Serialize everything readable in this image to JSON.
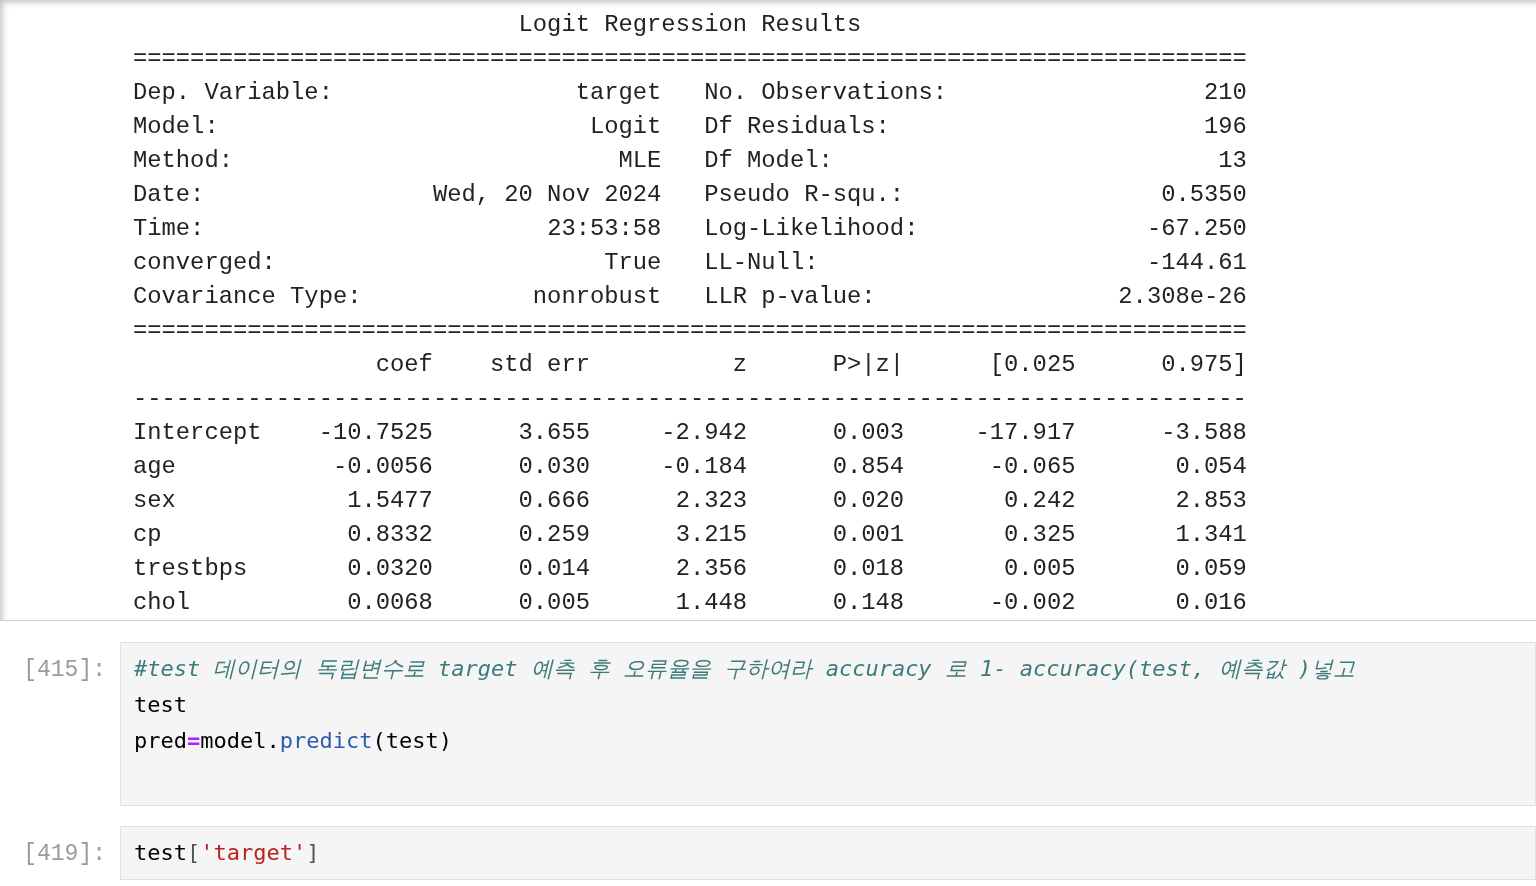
{
  "output": {
    "title": "Logit Regression Results",
    "rule_double": "==============================================================================",
    "rule_single": "------------------------------------------------------------------------------",
    "info_rows": [
      {
        "label": "Dep. Variable:",
        "value": "target",
        "label_2": "No. Observations:",
        "value_2": "210"
      },
      {
        "label": "Model:",
        "value": "Logit",
        "label_2": "Df Residuals:",
        "value_2": "196"
      },
      {
        "label": "Method:",
        "value": "MLE",
        "label_2": "Df Model:",
        "value_2": "13"
      },
      {
        "label": "Date:",
        "value": "Wed, 20 Nov 2024",
        "label_2": "Pseudo R-squ.:",
        "value_2": "0.5350"
      },
      {
        "label": "Time:",
        "value": "23:53:58",
        "label_2": "Log-Likelihood:",
        "value_2": "-67.250"
      },
      {
        "label": "converged:",
        "value": "True",
        "label_2": "LL-Null:",
        "value_2": "-144.61"
      },
      {
        "label": "Covariance Type:",
        "value": "nonrobust",
        "label_2": "LLR p-value:",
        "value_2": "2.308e-26"
      }
    ],
    "coef_columns": [
      "coef",
      "std err",
      "z",
      "P>|z|",
      "[0.025",
      "0.975]"
    ],
    "coef_rows": [
      {
        "name": "Intercept",
        "cells": [
          "-10.7525",
          "3.655",
          "-2.942",
          "0.003",
          "-17.917",
          "-3.588"
        ]
      },
      {
        "name": "age",
        "cells": [
          "-0.0056",
          "0.030",
          "-0.184",
          "0.854",
          "-0.065",
          "0.054"
        ]
      },
      {
        "name": "sex",
        "cells": [
          "1.5477",
          "0.666",
          "2.323",
          "0.020",
          "0.242",
          "2.853"
        ]
      },
      {
        "name": "cp",
        "cells": [
          "0.8332",
          "0.259",
          "3.215",
          "0.001",
          "0.325",
          "1.341"
        ]
      },
      {
        "name": "trestbps",
        "cells": [
          "0.0320",
          "0.014",
          "2.356",
          "0.018",
          "0.005",
          "0.059"
        ]
      },
      {
        "name": "chol",
        "cells": [
          "0.0068",
          "0.005",
          "1.448",
          "0.148",
          "-0.002",
          "0.016"
        ]
      }
    ]
  },
  "cells": [
    {
      "prompt": "[415]:",
      "lines": [
        [
          {
            "kind": "comment",
            "text": "#test 데이터의 독립변수로 target 예측 후 오류율을 구하여라 accuracy 로 1- accuracy(test, 예측값 )넣고"
          }
        ],
        [
          {
            "kind": "name",
            "text": "test"
          }
        ],
        [
          {
            "kind": "name",
            "text": "pred"
          },
          {
            "kind": "operator",
            "text": "="
          },
          {
            "kind": "name",
            "text": "model."
          },
          {
            "kind": "function",
            "text": "predict"
          },
          {
            "kind": "name",
            "text": "(test)"
          }
        ]
      ]
    },
    {
      "prompt": "[419]:",
      "lines": [
        [
          {
            "kind": "name",
            "text": "test"
          },
          {
            "kind": "punct",
            "text": "["
          },
          {
            "kind": "string",
            "text": "'target'"
          },
          {
            "kind": "punct",
            "text": "]"
          }
        ]
      ]
    }
  ]
}
